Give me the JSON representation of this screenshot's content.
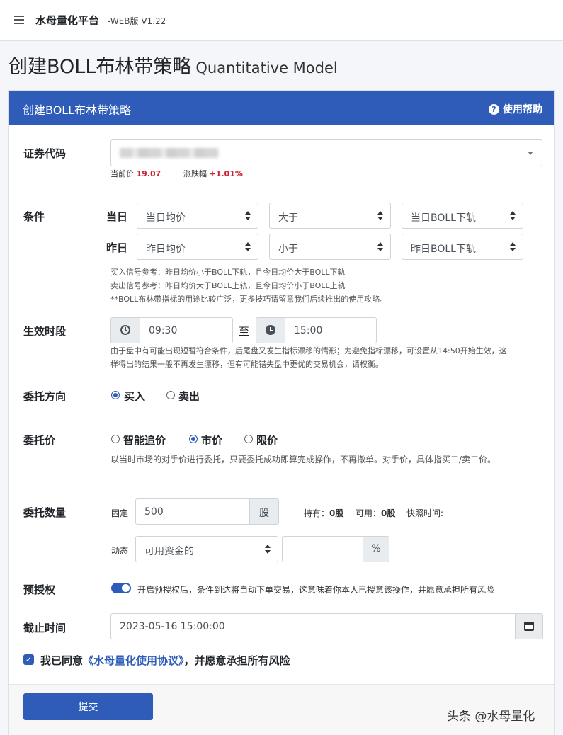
{
  "header": {
    "brand": "水母量化平台",
    "version": "-WEB版 V1.22"
  },
  "page": {
    "title": "创建BOLL布林带策略",
    "title_sub": "Quantitative Model"
  },
  "card": {
    "title": "创建BOLL布林带策略",
    "help_label": "使用帮助"
  },
  "security": {
    "label": "证券代码",
    "current_price_label": "当前价",
    "current_price": "19.07",
    "change_label": "涨跌幅",
    "change": "+1.01%"
  },
  "condition": {
    "label": "条件",
    "today_label": "当日",
    "yesterday_label": "昨日",
    "today": {
      "left": "当日均价",
      "op": "大于",
      "right": "当日BOLL下轨"
    },
    "yesterday": {
      "left": "昨日均价",
      "op": "小于",
      "right": "昨日BOLL下轨"
    },
    "hint_buy": "买入信号参考：昨日均价小于BOLL下轨，且今日均价大于BOLL下轨",
    "hint_sell": "卖出信号参考：昨日均价大于BOLL上轨，且今日均价小于BOLL上轨",
    "hint_note": "**BOLL布林带指标的用途比较广泛，更多技巧请留意我们后续推出的使用攻略。"
  },
  "period": {
    "label": "生效时段",
    "start": "09:30",
    "to_label": "至",
    "end": "15:00",
    "hint_1": "由于盘中有可能出现短暂符合条件，后尾盘又发生指标漂移的情形；为避免指标漂移，可设置从14:50开始生效，这",
    "hint_2": "样得出的结果一般不再发生漂移，但有可能错失盘中更优的交易机会，请权衡。"
  },
  "direction": {
    "label": "委托方向",
    "buy": "买入",
    "sell": "卖出",
    "selected": "buy"
  },
  "price": {
    "label": "委托价",
    "smart": "智能追价",
    "market": "市价",
    "limit": "限价",
    "selected": "market",
    "hint": "以当时市场的对手价进行委托，只要委托成功即算完成操作，不再撤单。对手价，具体指买二/卖二价。"
  },
  "quantity": {
    "label": "委托数量",
    "fixed_label": "固定",
    "fixed_value": "500",
    "fixed_unit": "股",
    "hold_label": "持有：",
    "hold_value": "0股",
    "avail_label": "可用：",
    "avail_value": "0股",
    "snapshot_label": "快照时间:",
    "dynamic_label": "动态",
    "dynamic_select": "可用资金的",
    "dynamic_value": "",
    "dynamic_unit": "%"
  },
  "preauth": {
    "label": "预授权",
    "enabled": true,
    "text": "开启预授权后，条件到达将自动下单交易，这意味着你本人已授意该操作，并愿意承担所有风险"
  },
  "deadline": {
    "label": "截止时间",
    "value": "2023-05-16 15:00:00"
  },
  "agree": {
    "prefix": "我已同意",
    "link": "《水母量化使用协议》",
    "suffix": "，并愿意承担所有风险"
  },
  "submit": {
    "label": "提交"
  },
  "watermark": "头条 @水母量化",
  "colors": {
    "primary": "#2e5cb8",
    "up": "#c82333"
  }
}
